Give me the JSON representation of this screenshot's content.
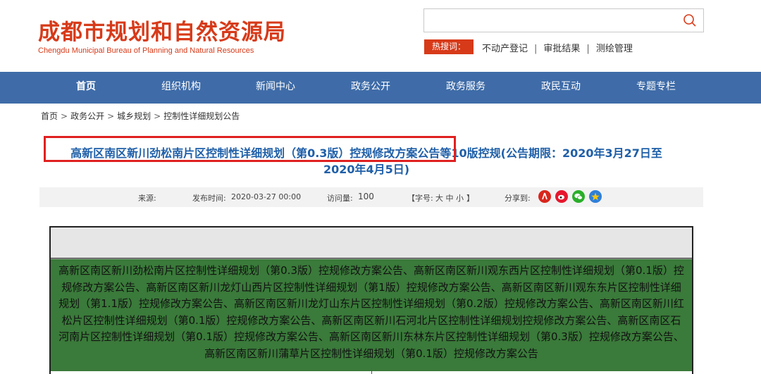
{
  "header": {
    "logo_cn": "成都市规划和自然资源局",
    "logo_en": "Chengdu Municipal Bureau of Planning and Natural Resources",
    "search": {
      "placeholder": "",
      "icon": "search-icon"
    },
    "hot_label": "热搜词：",
    "hot_links": [
      "不动产登记",
      "审批结果",
      "测绘管理"
    ],
    "hot_sep": "|"
  },
  "nav": {
    "items": [
      "首页",
      "组织机构",
      "新闻中心",
      "政务公开",
      "政务服务",
      "政民互动",
      "专题专栏"
    ],
    "active_index": 0
  },
  "breadcrumb": {
    "items": [
      "首页",
      "政务公开",
      "城乡规划",
      "控制性详细规划公告"
    ],
    "sep": ">"
  },
  "article": {
    "title_line1": "高新区南区新川劲松南片区控制性详细规划（第0.3版）控规修改方案公告等10版控规(公告期限：2020年3月27日至",
    "title_line2": "2020年4月5日)",
    "meta": {
      "source_label": "来源:",
      "publish_label": "发布时间:",
      "publish_time": "2020-03-27 00:00",
      "views_label": "访问量:",
      "views": "100",
      "font_label": "【字号:",
      "font_options": "大 中 小",
      "font_close": "】",
      "share_label": "分享到:"
    },
    "table_text": "高新区南区新川劲松南片区控制性详细规划（第0.3版）控规修改方案公告、高新区南区新川观东西片区控制性详细规划（第0.1版）控规修改方案公告、高新区南区新川龙灯山西片区控制性详细规划（第1版）控规修改方案公告、高新区南区新川观东东片区控制性详细规划（第1.1版）控规修改方案公告、高新区南区新川龙灯山东片区控制性详细规划（第0.2版）控规修改方案公告、高新区南区新川红松片区控制性详细规划（第0.1版）控规修改方案公告、高新区南区新川石河北片区控制性详细规划控规修改方案公告、高新区南区石河南片区控制性详细规划（第0.1版）控规修改方案公告、高新区南区新川东林东片区控制性详细规划（第0.3版）控规修改方案公告、高新区南区新川蒲草片区控制性详细规划（第0.1版）控规修改方案公告"
  },
  "colors": {
    "brand_red": "#d73a19",
    "nav_blue": "#3f6ca8",
    "title_blue": "#1f5fa8",
    "table_green": "#3a7a3a",
    "highlight_red": "#e02020"
  },
  "share_icons": [
    "renmin-icon",
    "weibo-icon",
    "wechat-icon",
    "qzone-icon"
  ]
}
